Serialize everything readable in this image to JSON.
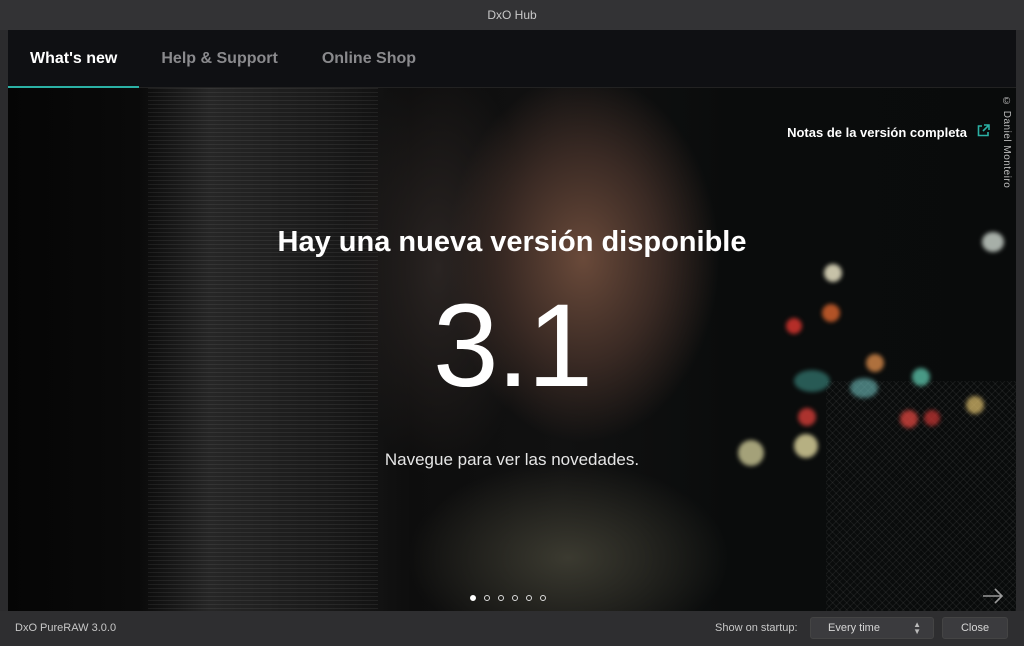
{
  "window": {
    "title": "DxO Hub"
  },
  "tabs": [
    {
      "label": "What's new",
      "active": true
    },
    {
      "label": "Help & Support",
      "active": false
    },
    {
      "label": "Online Shop",
      "active": false
    }
  ],
  "hero": {
    "photo_credit": "© Daniel Monteiro",
    "notes_link": "Notas de la versión completa",
    "notes_icon": "external-link-icon",
    "title": "Hay una nueva versión disponible",
    "version": "3.1",
    "subtitle": "Navegue para ver las novedades.",
    "slides_total": 6,
    "current_slide": 1,
    "next_icon": "arrow-right-icon"
  },
  "footer": {
    "app_version": "DxO PureRAW 3.0.0",
    "startup_label": "Show on startup:",
    "startup_value": "Every time",
    "close_label": "Close"
  },
  "colors": {
    "accent": "#2bb1a5",
    "background": "#2b2b2d"
  }
}
